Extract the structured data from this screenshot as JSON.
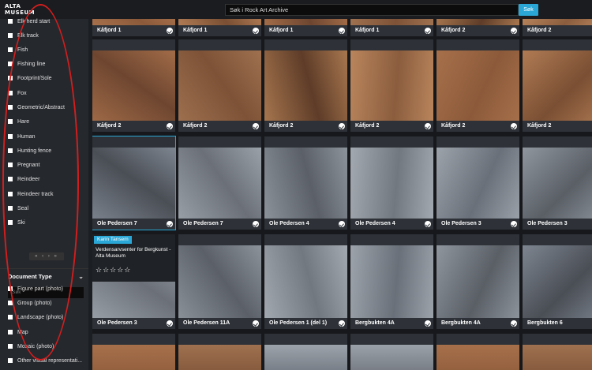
{
  "header": {
    "logo_line1": "ALTA",
    "logo_line2": "MUSEUM",
    "search_value": "Søk i Rock Art Archive",
    "search_button": "Søk"
  },
  "sidebar": {
    "filters": [
      {
        "label": "Elk herd start"
      },
      {
        "label": "Elk track"
      },
      {
        "label": "Fish"
      },
      {
        "label": "Fishing line"
      },
      {
        "label": "Footprint/Sole"
      },
      {
        "label": "Fox"
      },
      {
        "label": "Geometric/Abstract"
      },
      {
        "label": "Hare"
      },
      {
        "label": "Human"
      },
      {
        "label": "Hunting fence"
      },
      {
        "label": "Pregnant"
      },
      {
        "label": "Reindeer"
      },
      {
        "label": "Reindeer track"
      },
      {
        "label": "Seal"
      },
      {
        "label": "Ski"
      }
    ],
    "pager": "« ‹ › »",
    "doc_type_title": "Document Type",
    "doc_search_placeholder": "Søk",
    "doc_types": [
      {
        "label": "Figure part (photo)"
      },
      {
        "label": "Group (photo)"
      },
      {
        "label": "Landscape (photo)"
      },
      {
        "label": "Map"
      },
      {
        "label": "Mosaic (photo)"
      },
      {
        "label": "Other visual representati..."
      }
    ]
  },
  "tiles": [
    {
      "caption": "Kåfjord 1"
    },
    {
      "caption": "Kåfjord 1"
    },
    {
      "caption": "Kåfjord 1"
    },
    {
      "caption": "Kåfjord 1"
    },
    {
      "caption": "Kåfjord 2"
    },
    {
      "caption": "Kåfjord 2"
    },
    {
      "caption": "Kåfjord 2"
    },
    {
      "caption": "Kåfjord 2"
    },
    {
      "caption": "Kåfjord 2"
    },
    {
      "caption": "Kåfjord 2"
    },
    {
      "caption": "Kåfjord 2"
    },
    {
      "caption": "Kåfjord 2"
    },
    {
      "caption": "Ole Pedersen 7"
    },
    {
      "caption": "Ole Pedersen 7"
    },
    {
      "caption": "Ole Pedersen 4"
    },
    {
      "caption": "Ole Pedersen 4"
    },
    {
      "caption": "Ole Pedersen 3"
    },
    {
      "caption": "Ole Pedersen 3"
    },
    {
      "caption": "Ole Pedersen 3"
    },
    {
      "caption": "Ole Pedersen 11A"
    },
    {
      "caption": "Ole Pedersen 1 (del 1)"
    },
    {
      "caption": "Bergbukten 4A"
    },
    {
      "caption": "Bergbukten 4A"
    },
    {
      "caption": "Bergbukten 6"
    }
  ],
  "info_card": {
    "tag": "Karin Tansem",
    "text": "Verdensarvsenter for Bergkunst - Alta Museum",
    "stars": "☆☆☆☆☆"
  },
  "colors": {
    "accent": "#2aa7d6",
    "annotation": "#d21e1e"
  }
}
